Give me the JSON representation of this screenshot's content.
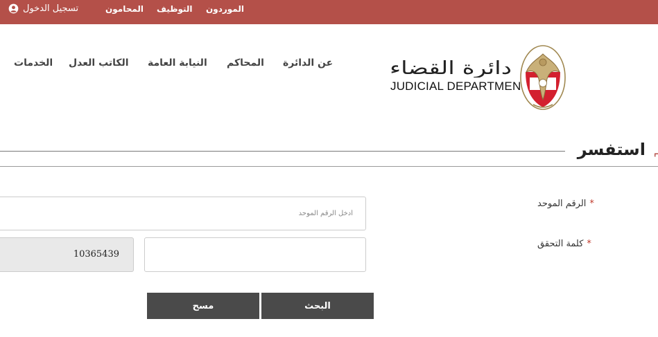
{
  "topbar": {
    "login_label": "تسجيل الدخول",
    "links": [
      "المحامون",
      "التوظيف",
      "الموردون"
    ]
  },
  "nav": {
    "items": [
      "عن الدائرة",
      "المحاكم",
      "النيابة العامة",
      "الكاتب العدل",
      "الخدمات"
    ]
  },
  "logo": {
    "arabic": "دائرة القضاء",
    "english": "JUDICIAL DEPARTMENT"
  },
  "page": {
    "title": "استفسر"
  },
  "form": {
    "unified_number": {
      "label": "الرقم الموحد",
      "placeholder": "أدخل الرقم الموحد",
      "value": ""
    },
    "captcha": {
      "label": "كلمة التحقق",
      "code": "10365439",
      "value": ""
    },
    "required_mark": "*",
    "search_button": "البحث",
    "clear_button": "مسح"
  },
  "colors": {
    "topbar": "#b45049",
    "button": "#4a4a4a",
    "required": "#c0392b"
  }
}
